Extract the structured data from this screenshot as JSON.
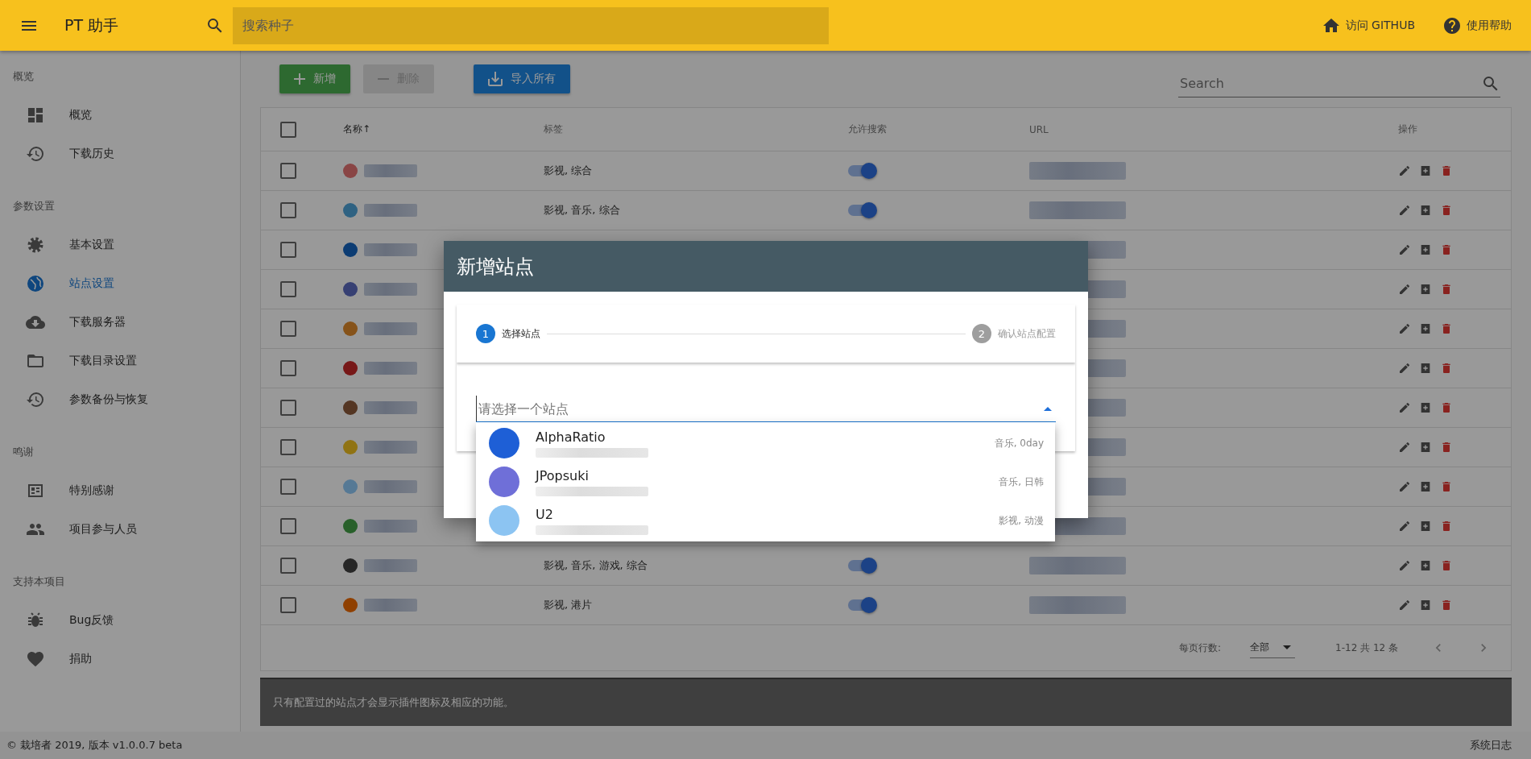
{
  "app_bar": {
    "title": "PT 助手",
    "search_placeholder": "搜索种子",
    "links": [
      "访问 GITHUB",
      "使用帮助"
    ]
  },
  "sidebar": {
    "groups": [
      {
        "heading": "概览",
        "items": [
          {
            "label": "概览",
            "selected": false
          },
          {
            "label": "下载历史",
            "selected": false
          }
        ]
      },
      {
        "heading": "参数设置",
        "items": [
          {
            "label": "基本设置",
            "selected": false
          },
          {
            "label": "站点设置",
            "selected": true
          },
          {
            "label": "下载服务器",
            "selected": false
          },
          {
            "label": "下载目录设置",
            "selected": false
          },
          {
            "label": "参数备份与恢复",
            "selected": false
          }
        ]
      },
      {
        "heading": "鸣谢",
        "items": [
          {
            "label": "特别感谢",
            "selected": false
          },
          {
            "label": "项目参与人员",
            "selected": false
          }
        ]
      },
      {
        "heading": "支持本项目",
        "items": [
          {
            "label": "Bug反馈",
            "selected": false
          },
          {
            "label": "捐助",
            "selected": false
          }
        ]
      }
    ]
  },
  "toolbar": {
    "buttons": [
      {
        "label": "新增",
        "disabled": false,
        "kind": "success"
      },
      {
        "label": "删除",
        "disabled": true,
        "kind": "plain"
      },
      {
        "label": "导入所有",
        "disabled": false,
        "kind": "primary"
      }
    ],
    "search_placeholder": "Search"
  },
  "table": {
    "header_checked": false,
    "columns": [
      "名称",
      "标签",
      "允许搜索",
      "URL",
      "操作"
    ],
    "sort_arrow": "↑",
    "rows": [
      {
        "checked": false,
        "tags": "影视, 综合",
        "search_enabled": true
      },
      {
        "checked": false,
        "tags": "影视, 音乐, 综合",
        "search_enabled": true
      },
      {
        "checked": false
      },
      {
        "checked": false
      },
      {
        "checked": false
      },
      {
        "checked": false
      },
      {
        "checked": false
      },
      {
        "checked": false
      },
      {
        "checked": false
      },
      {
        "checked": false
      },
      {
        "checked": false,
        "tags": "影视, 音乐, 游戏, 综合",
        "search_enabled": true
      },
      {
        "checked": false,
        "tags": "影视, 港片",
        "search_enabled": true
      }
    ],
    "pagination": {
      "rows_label": "每页行数:",
      "rows_value": "全部",
      "range": "1-12 共 12 条"
    }
  },
  "info_bar": "只有配置过的站点才会显示插件图标及相应的功能。",
  "footer": {
    "copyright": "© 栽培者 2019, 版本 v1.0.0.7 beta",
    "log_link": "系统日志"
  },
  "dialog": {
    "title": "新增站点",
    "steps": [
      {
        "number": "1",
        "label": "选择站点",
        "selected": true
      },
      {
        "number": "2",
        "label": "确认站点配置",
        "selected": false
      }
    ],
    "select_placeholder": "请选择一个站点",
    "options": [
      {
        "name": "AlphaRatio",
        "tags": "音乐, 0day"
      },
      {
        "name": "JPopsuki",
        "tags": "音乐, 日韩"
      },
      {
        "name": "U2",
        "tags": "影视, 动漫"
      }
    ]
  }
}
